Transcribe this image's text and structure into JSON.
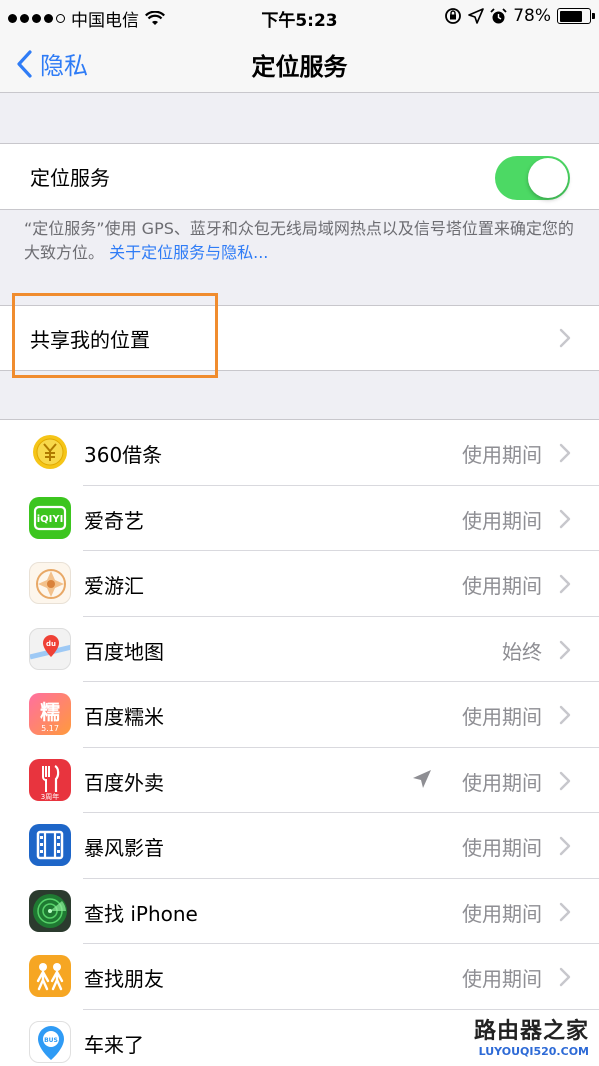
{
  "status_bar": {
    "carrier": "中国电信",
    "time": "下午5:23",
    "battery": "78%",
    "battery_level": 0.78,
    "signal_bars": 4,
    "signal_max": 5,
    "icons": [
      "wifi-icon",
      "rotation-lock-icon",
      "location-arrow-icon",
      "alarm-icon",
      "battery-icon"
    ]
  },
  "nav": {
    "back_label": "隐私",
    "title": "定位服务"
  },
  "location_services": {
    "label": "定位服务",
    "enabled": true
  },
  "footer": {
    "text": "“定位服务”使用 GPS、蓝牙和众包无线局域网热点以及信号塔位置来确定您的大致方位。",
    "link": "关于定位服务与隐私..."
  },
  "share_location": {
    "label": "共享我的位置"
  },
  "apps": [
    {
      "name": "360借条",
      "value": "使用期间",
      "icon": "360-jietiao-icon",
      "recent_location": false
    },
    {
      "name": "爱奇艺",
      "value": "使用期间",
      "icon": "iqiyi-icon",
      "recent_location": false
    },
    {
      "name": "爱游汇",
      "value": "使用期间",
      "icon": "aiyouhui-icon",
      "recent_location": false
    },
    {
      "name": "百度地图",
      "value": "始终",
      "icon": "baidu-map-icon",
      "recent_location": false
    },
    {
      "name": "百度糯米",
      "value": "使用期间",
      "icon": "baidu-nuomi-icon",
      "recent_location": false
    },
    {
      "name": "百度外卖",
      "value": "使用期间",
      "icon": "baidu-waimai-icon",
      "recent_location": true
    },
    {
      "name": "暴风影音",
      "value": "使用期间",
      "icon": "baofeng-icon",
      "recent_location": false
    },
    {
      "name": "查找 iPhone",
      "value": "使用期间",
      "icon": "find-iphone-icon",
      "recent_location": false
    },
    {
      "name": "查找朋友",
      "value": "使用期间",
      "icon": "find-friends-icon",
      "recent_location": false
    },
    {
      "name": "车来了",
      "value": "",
      "icon": "chelaile-icon",
      "recent_location": false
    }
  ],
  "icon_texts": {
    "nuomi_char": "糯",
    "nuomi_date": "5.17",
    "waimai_badge": "3周年",
    "baidu_du": "du",
    "bus": "BUS",
    "iqiyi": "iQIYI"
  },
  "watermark": {
    "title": "路由器之家",
    "url": "LUYOUQI520.COM"
  },
  "colors": {
    "accent": "#2f7cf6",
    "toggle_on": "#4cd964",
    "highlight": "#f08c2e"
  }
}
